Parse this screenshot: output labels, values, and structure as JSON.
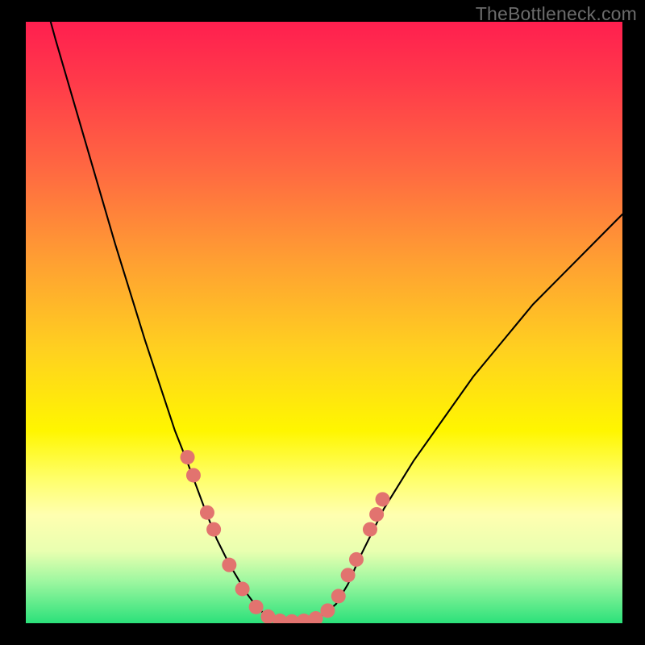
{
  "watermark": "TheBottleneck.com",
  "colors": {
    "background": "#000000",
    "marker_fill": "#e2736f",
    "curve_stroke": "#000000",
    "gradient_top": "#ff1f4f",
    "gradient_bottom": "#2be17a"
  },
  "chart_data": {
    "type": "line",
    "title": "",
    "subtitle": "",
    "xlabel": "",
    "ylabel": "",
    "xlim": [
      0,
      100
    ],
    "ylim": [
      0,
      100
    ],
    "legend": false,
    "annotations": [],
    "series": [
      {
        "name": "bottleneck-curve",
        "x": [
          0,
          5,
          10,
          15,
          20,
          25,
          27,
          30,
          32,
          34,
          37,
          38.5,
          40,
          42,
          44,
          46,
          48,
          50,
          52,
          54,
          56,
          60,
          65,
          70,
          75,
          80,
          85,
          90,
          95,
          100
        ],
        "y": [
          115,
          97,
          80,
          63,
          47,
          32,
          27,
          19,
          14,
          10,
          5,
          3,
          1.5,
          0.6,
          0.2,
          0.2,
          0.5,
          1.5,
          3.2,
          6.5,
          11,
          19,
          27,
          34,
          41,
          47,
          53,
          58,
          63,
          68
        ]
      }
    ],
    "markers": {
      "name": "highlighted-points",
      "x": [
        27.1,
        28.1,
        30.4,
        31.5,
        34.1,
        36.3,
        38.6,
        40.6,
        42.6,
        44.6,
        46.6,
        48.6,
        50.6,
        52.4,
        54.0,
        55.4,
        57.7,
        58.8,
        59.8
      ],
      "y": [
        27.6,
        24.6,
        18.4,
        15.6,
        9.7,
        5.7,
        2.7,
        1.1,
        0.4,
        0.3,
        0.4,
        0.8,
        2.1,
        4.5,
        8.0,
        10.6,
        15.6,
        18.1,
        20.6
      ]
    }
  }
}
